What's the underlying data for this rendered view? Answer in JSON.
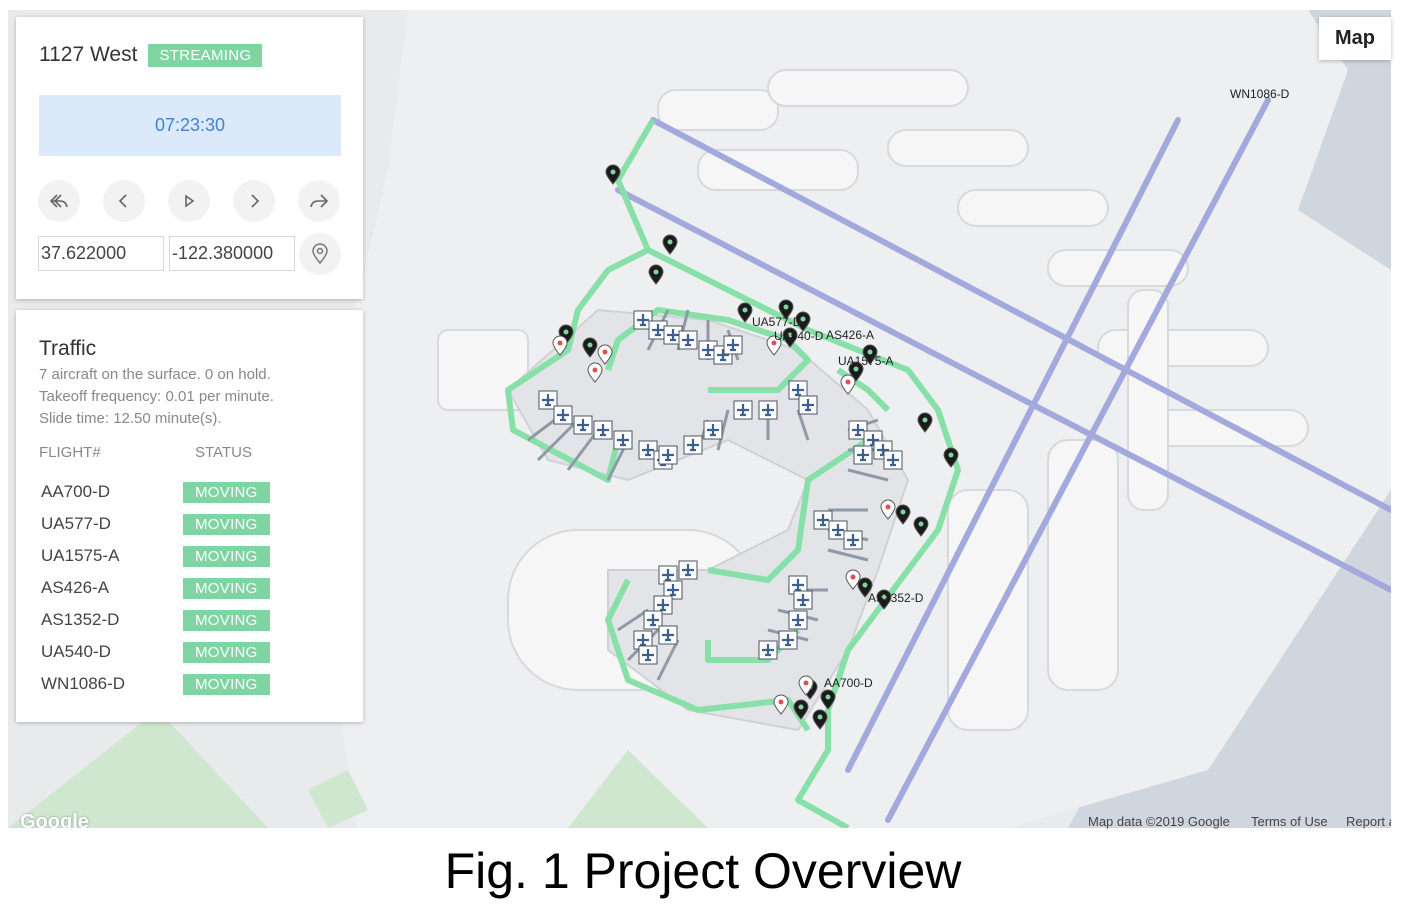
{
  "header": {
    "title": "1127 West",
    "badge": "STREAMING"
  },
  "clock": "07:23:30",
  "controls": [
    "rewind-icon",
    "prev-icon",
    "play-icon",
    "next-icon",
    "forward-icon"
  ],
  "coords": {
    "lat": "37.622000",
    "lng": "-122.380000"
  },
  "traffic": {
    "title": "Traffic",
    "summary": "7 aircraft on the surface. 0 on hold.",
    "takeoff": "Takeoff frequency: 0.01 per minute.",
    "slide": "Slide time: 12.50 minute(s).",
    "col_flight": "FLIGHT#",
    "col_status": "STATUS",
    "rows": [
      {
        "flight": "AA700-D",
        "status": "MOVING"
      },
      {
        "flight": "UA577-D",
        "status": "MOVING"
      },
      {
        "flight": "UA1575-A",
        "status": "MOVING"
      },
      {
        "flight": "AS426-A",
        "status": "MOVING"
      },
      {
        "flight": "AS1352-D",
        "status": "MOVING"
      },
      {
        "flight": "UA540-D",
        "status": "MOVING"
      },
      {
        "flight": "WN1086-D",
        "status": "MOVING"
      }
    ]
  },
  "map": {
    "type_button": "Map",
    "labels": {
      "wn1086": "WN1086-D",
      "ua577": "UA577-D",
      "ua540": "UA540-D",
      "as426": "AS426-A",
      "ua1575": "UA1575-A",
      "as1352": "AS1352-D",
      "aa700": "AA700-D"
    },
    "attribution": {
      "data": "Map data ©2019 Google",
      "terms": "Terms of Use",
      "report": "Report a"
    },
    "logo": "Google"
  },
  "caption": "Fig. 1 Project Overview",
  "colors": {
    "badge": "#7fd5a2",
    "clock_bg": "#dce9fa",
    "clock_text": "#3f84d6",
    "route": "#86e0a8",
    "runway": "#a3a9dc",
    "water": "#cfd6dd"
  }
}
